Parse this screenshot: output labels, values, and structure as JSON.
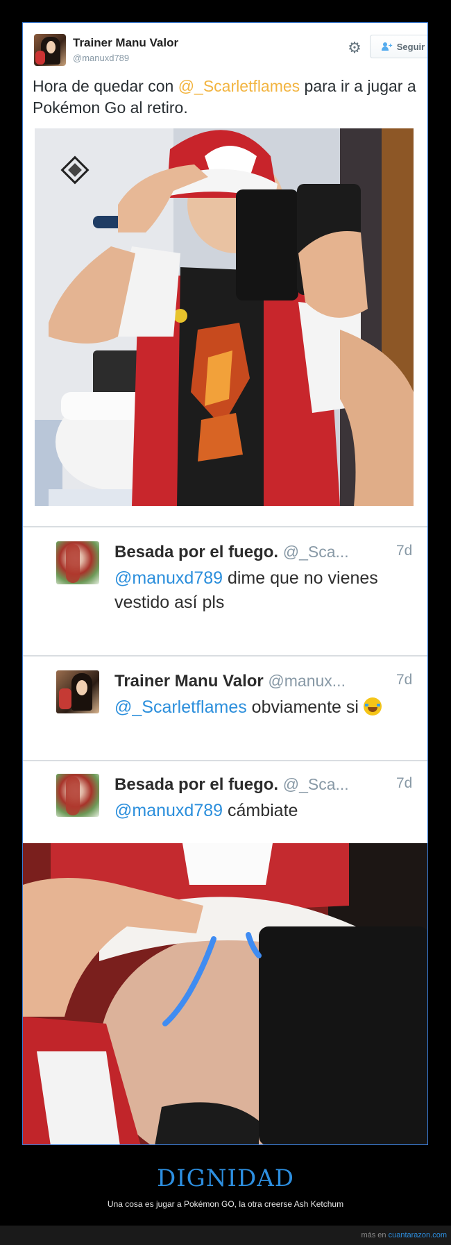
{
  "tweet": {
    "author_name": "Trainer Manu Valor",
    "author_handle": "@manuxd789",
    "follow_label": "Seguir",
    "text_before": "Hora de quedar con ",
    "mention": "@_Scarletflames",
    "text_after": " para ir a jugar a Pokémon Go al retiro.",
    "icons": {
      "settings": "gear-icon",
      "follow": "add-user-icon"
    }
  },
  "replies": [
    {
      "name": "Besada por el fuego.",
      "handle": "@_Sca...",
      "time": "7d",
      "mention": "@manuxd789",
      "text": " dime que no vienes vestido así pls"
    },
    {
      "name": "Trainer Manu Valor",
      "handle": "@manux...",
      "time": "7d",
      "mention": "@_Scarletflames",
      "text": " obviamente si ",
      "emoji": "tears-of-joy-emoji"
    },
    {
      "name": "Besada por el fuego.",
      "handle": "@_Sca...",
      "time": "7d",
      "mention": "@manuxd789",
      "text": " cámbiate"
    }
  ],
  "post": {
    "title": "DIGNIDAD",
    "subtitle": "Una cosa es jugar a Pokémon GO, la otra creerse Ash Ketchum",
    "more_prefix": "más en ",
    "more_link": "cuantarazon.com"
  },
  "colors": {
    "accent": "#2d8fe0",
    "mention_orange": "#f2b440",
    "mention_blue": "#2c8fdc",
    "frame_border": "#3a7bd5"
  }
}
